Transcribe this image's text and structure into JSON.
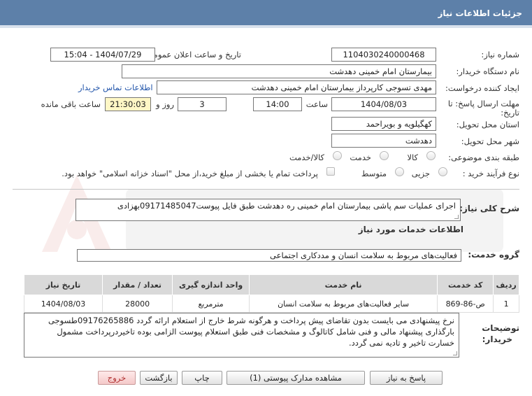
{
  "header": {
    "title": "جزئیات اطلاعات نیاز"
  },
  "labels": {
    "need_number": "شماره نیاز:",
    "announce_datetime": "تاریخ و ساعت اعلان عمومی:",
    "buyer_org": "نام دستگاه خریدار:",
    "request_creator": "ایجاد کننده درخواست:",
    "reply_deadline_1": "مهلت ارسال پاسخ: تا",
    "reply_deadline_2": "تاریخ:",
    "time": "ساعت",
    "day_and": "روز و",
    "remaining": "ساعت باقی مانده",
    "province": "استان محل تحویل:",
    "city": "شهر محل تحویل:",
    "subject_category": "طبقه بندی موضوعی:",
    "purchase_type": "نوع فرآیند خرید :",
    "need_description": "شرح کلی نیاز:",
    "services_info": "اطلاعات خدمات مورد نیاز",
    "service_group": "گروه خدمت:",
    "buyer_notes_1": "توضیحات",
    "buyer_notes_2": "خریدار:"
  },
  "fields": {
    "need_number": "1104030240000468",
    "announce_datetime": "1404/07/29 - 15:04",
    "buyer_org": "بیمارستان امام خمینی دهدشت",
    "request_creator": "مهدی تسوجی کارپرداز بیمارستان امام خمینی دهدشت",
    "contact_link": "اطلاعات تماس خریدار",
    "reply_date": "1404/08/03",
    "reply_time": "14:00",
    "days": "3",
    "remaining_time": "21:30:03",
    "province": "کهگیلویه و بویراحمد",
    "city": "دهدشت",
    "need_description": "اجرای عملیات سم پاشی بیمارستان امام خمینی ره دهدشت طبق فایل پیوست09171485047بهزادی",
    "service_group": "فعالیت‌های مربوط به سلامت انسان و مددکاری اجتماعی",
    "buyer_notes": "نرخ پیشنهادی می بایست بدون تقاضای پیش پرداخت و هرگونه شرط خارج از استعلام ارائه گردد 09176265886طسوجی بارگذاری پیشنهاد مالی و فنی شامل کاتالوگ و مشخصات فنی طبق استعلام پیوست الزامی بوده تاخیردرپرداخت مشمول خسارت تاخیر و تادیه نمی گردد."
  },
  "subject_options": [
    "کالا",
    "خدمت",
    "کالا/خدمت"
  ],
  "purchase_options": [
    "جزیی",
    "متوسط"
  ],
  "payment_note": "پرداخت تمام یا بخشی از مبلغ خرید،از محل \"اسناد خزانه اسلامی\" خواهد بود.",
  "table": {
    "headers": [
      "ردیف",
      "کد خدمت",
      "نام خدمت",
      "واحد اندازه گیری",
      "تعداد / مقدار",
      "تاریخ نیاز"
    ],
    "rows": [
      [
        "1",
        "ص-86-869",
        "سایر فعالیت‌های مربوط به سلامت انسان",
        "مترمربع",
        "28000",
        "1404/08/03"
      ]
    ]
  },
  "buttons": {
    "reply": "پاسخ به نیاز",
    "view_docs": "مشاهده مدارک پیوستی (1)",
    "print": "چاپ",
    "back": "بازگشت",
    "exit": "خروج"
  },
  "colors": {
    "header_bg": "#5d80a9",
    "remaining_bg": "#fff7c6",
    "link": "#2255aa"
  }
}
